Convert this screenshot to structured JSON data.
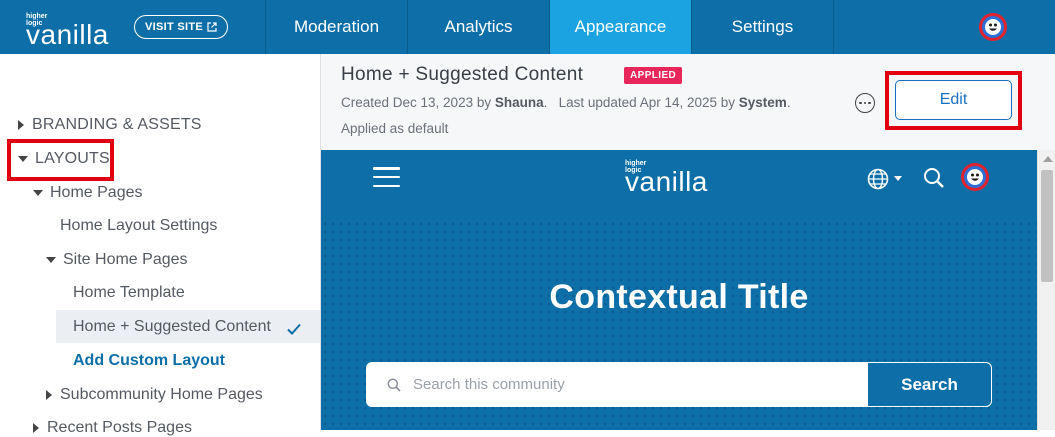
{
  "topbar": {
    "brand_small": "higher logic",
    "brand_word": "vanilla",
    "visit_site": "VISIT SITE",
    "tabs": [
      {
        "label": "Moderation"
      },
      {
        "label": "Analytics"
      },
      {
        "label": "Appearance"
      },
      {
        "label": "Settings"
      }
    ],
    "active_tab": "Appearance"
  },
  "sidebar": {
    "branding": "BRANDING & ASSETS",
    "layouts": "LAYOUTS",
    "home_pages": "Home Pages",
    "home_layout_settings": "Home Layout Settings",
    "site_home_pages": "Site Home Pages",
    "home_template": "Home Template",
    "home_suggested": "Home + Suggested Content",
    "add_custom_layout": "Add Custom Layout",
    "subcommunity_home_pages": "Subcommunity Home Pages",
    "recent_posts_pages": "Recent Posts Pages"
  },
  "header": {
    "title": "Home + Suggested Content",
    "badge": "APPLIED",
    "created_prefix": "Created Dec 13, 2023 by ",
    "created_by": "Shauna",
    "updated_prefix": ".   Last updated Apr 14, 2025 by ",
    "updated_by": "System",
    "updated_suffix": ".",
    "applied_default": "Applied as default",
    "edit_label": "Edit"
  },
  "preview": {
    "brand_small": "higher logic",
    "brand_word": "vanilla",
    "hero_title": "Contextual Title",
    "search_placeholder": "Search this community",
    "search_button": "Search"
  },
  "colors": {
    "brand_blue": "#0e6fa8",
    "active_tab": "#1aa3e0",
    "badge_pink": "#e8265a",
    "highlight_red": "#e0000f"
  }
}
